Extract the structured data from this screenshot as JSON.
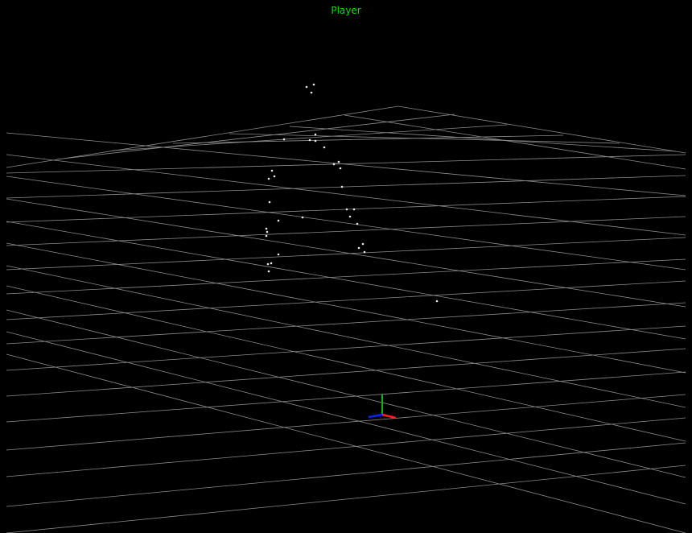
{
  "header": {
    "label": "Player"
  },
  "colors": {
    "background": "#000000",
    "label": "#00e000",
    "grid": "#8a8a8a",
    "points": "#e8e8e8",
    "axis_x": "#ff2020",
    "axis_y": "#10b010",
    "axis_z": "#1020ff"
  },
  "scene": {
    "grid": "visible",
    "point_count": 36,
    "axes_gizmo": [
      "x-axis",
      "y-axis",
      "z-axis"
    ]
  }
}
